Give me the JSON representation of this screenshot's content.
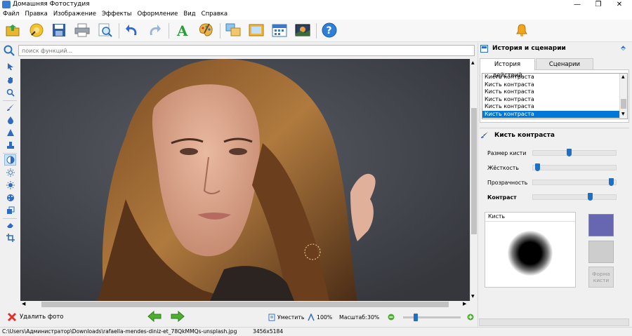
{
  "window": {
    "title": "Домашняя Фотостудия"
  },
  "menu": [
    "Файл",
    "Правка",
    "Изображение",
    "Эффекты",
    "Оформление",
    "Вид",
    "Справка"
  ],
  "search": {
    "placeholder": "поиск функций..."
  },
  "right_panel": {
    "header": "История и сценарии",
    "tabs": [
      "История действий",
      "Сценарии"
    ],
    "active_tab": "История действий",
    "history": [
      "Кисть контраста",
      "Кисть контраста",
      "Кисть контраста",
      "Кисть контраста",
      "Кисть контраста",
      "Кисть контраста"
    ],
    "selected_history_index": 5,
    "tool_title": "Кисть контраста",
    "sliders": [
      {
        "label": "Размер кисти",
        "value": 0.43
      },
      {
        "label": "Жёсткость",
        "value": 0.03
      },
      {
        "label": "Прозрачность",
        "value": 0.97
      },
      {
        "label": "Контраст",
        "value": 0.7
      }
    ],
    "brush_label": "Кисть",
    "brush_color": "#6667b0",
    "form_button": "Форма кисти"
  },
  "bottom": {
    "delete_label": "Удалить фото",
    "fit_label": "Уместить",
    "zoom100_label": "100%",
    "scale_label": "Масштаб:",
    "scale_value": "30%",
    "zoom_slider_value": 0.2
  },
  "status": {
    "path": "C:\\Users\\Администратор\\Downloads\\rafaella-mendes-diniz-et_78QkMMQs-unsplash.jpg",
    "dimensions": "3456x5184"
  },
  "colors": {
    "accent": "#0078d7",
    "slider_thumb": "#1e6fc6",
    "canvas_bg": "#4a4d55"
  }
}
